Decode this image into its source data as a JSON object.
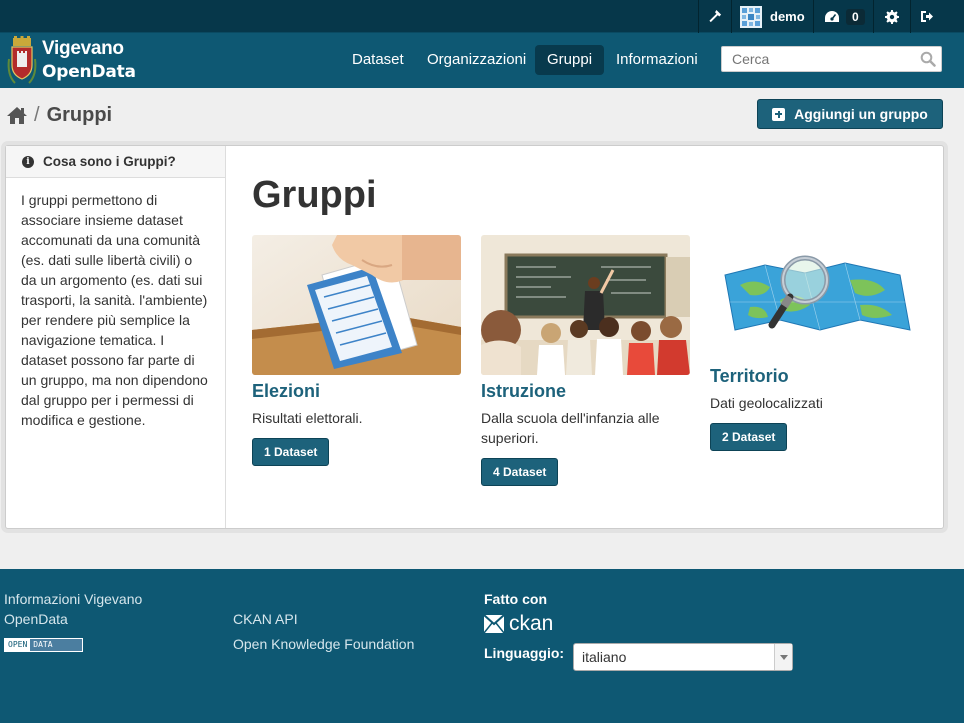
{
  "account": {
    "user": "demo",
    "activity_count": "0"
  },
  "site": {
    "name_line1": "Vigevano",
    "name_line2": "OpenData"
  },
  "nav": {
    "items": [
      {
        "label": "Dataset"
      },
      {
        "label": "Organizzazioni"
      },
      {
        "label": "Gruppi"
      },
      {
        "label": "Informazioni"
      }
    ],
    "active": "Gruppi"
  },
  "search": {
    "placeholder": "Cerca"
  },
  "breadcrumb": {
    "separator": "/",
    "current": "Gruppi"
  },
  "toolbar": {
    "add_label": "Aggiungi un gruppo"
  },
  "sidebar": {
    "heading": "Cosa sono i Gruppi?",
    "body": "I gruppi permettono di associare insieme dataset accomunati da una comunità (es. dati sulle libertà civili) o da un argomento (es. dati sui trasporti, la sanità. l'ambiente) per rendere più semplice la navigazione tematica. I dataset possono far parte di un gruppo, ma non dipendono dal gruppo per i permessi di modifica e gestione."
  },
  "main": {
    "title": "Gruppi",
    "groups": [
      {
        "title": "Elezioni",
        "description": "Risultati elettorali.",
        "datasets": "1 Dataset"
      },
      {
        "title": "Istruzione",
        "description": "Dalla scuola dell'infanzia alle superiori.",
        "datasets": "4 Dataset"
      },
      {
        "title": "Territorio",
        "description": "Dati geolocalizzati",
        "datasets": "2 Dataset"
      }
    ]
  },
  "footer": {
    "about": "Informazioni Vigevano OpenData",
    "badge_left": "OPEN",
    "badge_right": "DATA",
    "api": "CKAN API",
    "okfn": "Open Knowledge Foundation",
    "made_with": "Fatto con",
    "ckan": "ckan",
    "language_label": "Linguaggio:",
    "language_value": "italiano"
  },
  "colors": {
    "header": "#0e5873",
    "account_bar": "#06374a",
    "accent": "#1d627b",
    "background": "#efefef"
  }
}
